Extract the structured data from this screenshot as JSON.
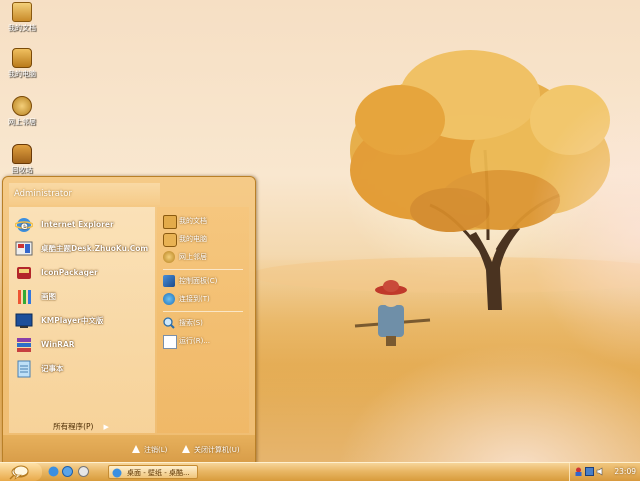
{
  "desktop": {
    "icons": [
      {
        "label": "我的文档",
        "icon": "folder-documents-icon"
      },
      {
        "label": "我的电脑",
        "icon": "computer-icon"
      },
      {
        "label": "网上邻居",
        "icon": "network-places-icon"
      },
      {
        "label": "回收站",
        "icon": "recycle-bin-icon"
      }
    ]
  },
  "start_menu": {
    "user": "Administrator",
    "programs": [
      {
        "label": "Internet Explorer",
        "icon": "internet-explorer-icon"
      },
      {
        "label": "桌酷主题Desk.ZhuoKu.Com",
        "icon": "zhuoku-theme-icon"
      },
      {
        "label": "IconPackager",
        "icon": "iconpackager-icon"
      },
      {
        "label": "画图",
        "icon": "paint-icon"
      },
      {
        "label": "KMPlayer中文版",
        "icon": "kmplayer-icon"
      },
      {
        "label": "WinRAR",
        "icon": "winrar-icon"
      },
      {
        "label": "记事本",
        "icon": "notepad-icon"
      }
    ],
    "all_programs": "所有程序(P)",
    "places": [
      {
        "label": "我的文档",
        "icon": "my-documents-icon"
      },
      {
        "label": "我的电脑",
        "icon": "my-computer-icon"
      },
      {
        "label": "网上邻居",
        "icon": "network-icon"
      }
    ],
    "system": [
      {
        "label": "控制面板(C)",
        "icon": "control-panel-icon"
      },
      {
        "label": "连接到(T)",
        "icon": "connect-icon"
      }
    ],
    "tools": [
      {
        "label": "搜索(S)",
        "icon": "search-icon"
      },
      {
        "label": "运行(R)...",
        "icon": "run-icon"
      }
    ],
    "logoff": "注销(L)",
    "shutdown": "关闭计算机(U)"
  },
  "taskbar": {
    "task_label": "桌面 - 壁纸 - 桌酷...",
    "clock": "23:09"
  },
  "colors": {
    "accent": "#d99c47",
    "menu_border": "#b98028",
    "tree_foliage": "#e2a33a"
  }
}
